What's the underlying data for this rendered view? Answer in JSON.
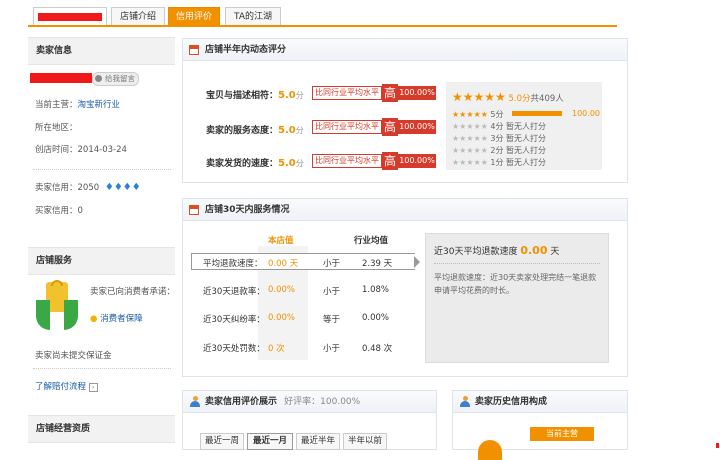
{
  "tabs": [
    {
      "label": "店铺介绍"
    },
    {
      "label": "信用评价"
    },
    {
      "label": "TA的江湖"
    }
  ],
  "sidebar": {
    "seller_info_title": "卖家信息",
    "leave_message": "给我留言",
    "main_business_label": "当前主营：",
    "main_business_value": "淘宝新行业",
    "region_label": "所在地区：",
    "created_label": "创店时间：",
    "created_value": "2014-03-24",
    "seller_credit_label": "卖家信用：",
    "seller_credit_value": "2050",
    "buyer_credit_label": "买家信用：",
    "buyer_credit_value": "0",
    "shop_service_title": "店铺服务",
    "promise_text": "卖家已向消费者承诺：",
    "consumer_guarantee": "消费者保障",
    "no_deposit": "卖家尚未提交保证金",
    "compensation_link": "了解赔付流程",
    "qualification_title": "店铺经营资质"
  },
  "dsr": {
    "title": "店铺半年内动态评分",
    "rows": [
      {
        "label": "宝贝与描述相符：",
        "score": "5.0",
        "unit": "分",
        "compare_label": "比同行业平均水平",
        "high": "高",
        "pct": "100.00%"
      },
      {
        "label": "卖家的服务态度：",
        "score": "5.0",
        "unit": "分",
        "compare_label": "比同行业平均水平",
        "high": "高",
        "pct": "100.00%"
      },
      {
        "label": "卖家发货的速度：",
        "score": "5.0",
        "unit": "分",
        "compare_label": "比同行业平均水平",
        "high": "高",
        "pct": "100.00%"
      }
    ],
    "summary_score": "5.0分",
    "summary_total": "共409人",
    "distribution": [
      {
        "label": "5分",
        "pct": "100.00",
        "fill": 1.0
      },
      {
        "label": "4分",
        "text": "暂无人打分"
      },
      {
        "label": "3分",
        "text": "暂无人打分"
      },
      {
        "label": "2分",
        "text": "暂无人打分"
      },
      {
        "label": "1分",
        "text": "暂无人打分"
      }
    ]
  },
  "service": {
    "title": "店铺30天内服务情况",
    "col_shop": "本店值",
    "col_industry": "行业均值",
    "rows": [
      {
        "label": "平均退款速度：",
        "shop": "0.00 天",
        "cmp": "小于",
        "industry": "2.39 天"
      },
      {
        "label": "近30天退款率：",
        "shop": "0.00%",
        "cmp": "小于",
        "industry": "1.08%"
      },
      {
        "label": "近30天纠纷率：",
        "shop": "0.00%",
        "cmp": "等于",
        "industry": "0.00%"
      },
      {
        "label": "近30天处罚数：",
        "shop": "0 次",
        "cmp": "小于",
        "industry": "0.48 次"
      }
    ],
    "info_title_prefix": "近30天平均退款速度",
    "info_title_value": "0.00",
    "info_title_unit": "天",
    "info_desc": "平均退款速度：近30天卖家处理完结一笔退款申请平均花费的时长。"
  },
  "credit_display": {
    "title": "卖家信用评价展示",
    "good_rate_label": "好评率：",
    "good_rate_value": "100.00%",
    "filters": [
      "最近一周",
      "最近一月",
      "最近半年",
      "半年以前"
    ]
  },
  "history": {
    "title": "卖家历史信用构成",
    "current_main": "当前主营"
  },
  "colors": {
    "accent": "#f29100",
    "red": "#d63a2a",
    "link": "#1a5aa8"
  }
}
